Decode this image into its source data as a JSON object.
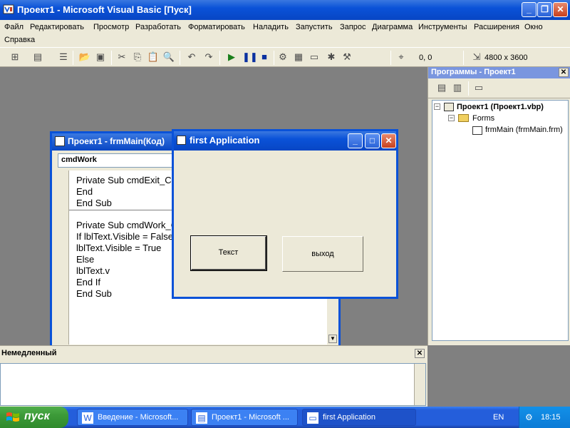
{
  "main_window": {
    "title": "Проект1 - Microsoft Visual Basic [Пуск]",
    "minimize": "_",
    "maximize": "❐",
    "close": "✕"
  },
  "menu": {
    "items": [
      "Файл",
      "Редактировать",
      "Просмотр",
      "Разработать",
      "Форматировать",
      "Наладить",
      "Запустить",
      "Запрос",
      "Диаграмма",
      "Инструменты",
      "Расширения",
      "Окно",
      "Справка"
    ]
  },
  "toolbar": {
    "position": "0, 0",
    "size": "4800 x 3600"
  },
  "project_explorer": {
    "title": "Программы - Проект1",
    "close": "✕",
    "tree": {
      "root": "Проект1 (Проект1.vbp)",
      "folder": "Forms",
      "form": "frmMain (frmMain.frm)"
    }
  },
  "code_window": {
    "title": "Проект1 - frmMain(Код)",
    "object_combo": "cmdWork",
    "lines": [
      "Private Sub cmdExit_Click()",
      "        End",
      "End Sub",
      "Private Sub cmdWork_Click()",
      "If lblText.Visible = False Then",
      "lblText.Visible = True",
      "Else",
      "lblText.v",
      "End If",
      "End Sub"
    ]
  },
  "form_window": {
    "title": "first Application",
    "button_text": "Текст",
    "button_exit": "выход"
  },
  "immediate": {
    "title": "Немедленный",
    "close": "✕"
  },
  "taskbar": {
    "start_label": "пуск",
    "tasks": [
      "Введение - Microsoft...",
      "Проект1 - Microsoft ...",
      "first Application"
    ],
    "language": "EN",
    "clock": "18:15"
  },
  "colors": {
    "xp_blue": "#0a52d8",
    "face": "#ece9d8",
    "workspace": "#808080",
    "start_green": "#3c9a38"
  }
}
